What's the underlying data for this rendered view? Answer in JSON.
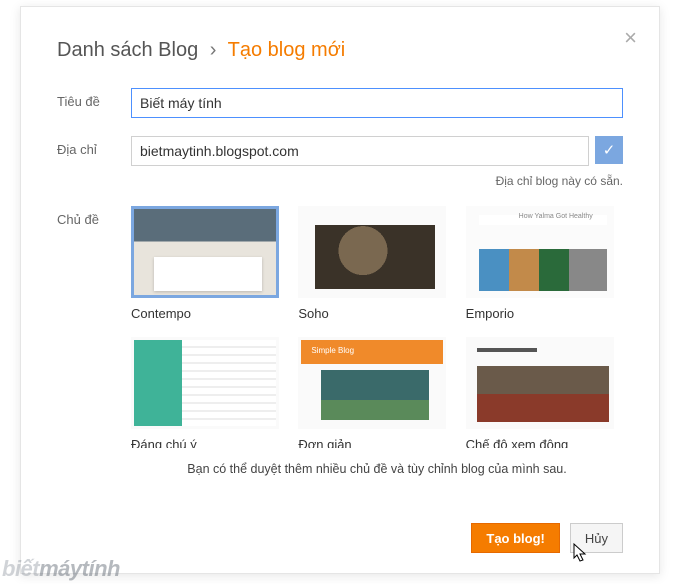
{
  "header": {
    "breadcrumb": "Danh sách Blog",
    "arrow": "›",
    "title": "Tạo blog mới"
  },
  "labels": {
    "title_field": "Tiêu đề",
    "address_field": "Địa chỉ",
    "theme_field": "Chủ đề"
  },
  "inputs": {
    "title_value": "Biết máy tính",
    "address_value": "bietmaytinh.blogspot.com"
  },
  "status": {
    "address_available": "Địa chỉ blog này có sẵn."
  },
  "themes": [
    {
      "name": "Contempo",
      "klass": "th-contempo",
      "selected": true
    },
    {
      "name": "Soho",
      "klass": "th-soho",
      "selected": false,
      "thumbtitle": ""
    },
    {
      "name": "Emporio",
      "klass": "th-emporio",
      "selected": false,
      "thumbtitle": "How Yalma Got Healthy"
    },
    {
      "name": "Đáng chú ý",
      "klass": "th-dangchuy",
      "selected": false
    },
    {
      "name": "Đơn giản",
      "klass": "th-dongian",
      "selected": false,
      "thumbtitle": "Simple Blog"
    },
    {
      "name": "Chế độ xem động",
      "klass": "th-dynamic",
      "selected": false
    }
  ],
  "hint": "Bạn có thể duyệt thêm nhiều chủ đề và tùy chỉnh blog của mình sau.",
  "buttons": {
    "create": "Tạo blog!",
    "cancel": "Hủy"
  },
  "watermark": {
    "part1": "biết",
    "part2": "máytính"
  },
  "icons": {
    "check": "✓",
    "close": "×"
  }
}
